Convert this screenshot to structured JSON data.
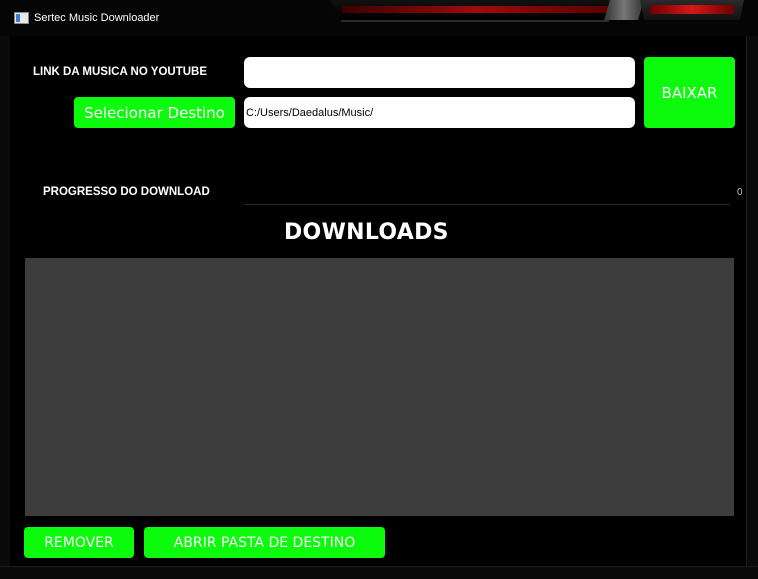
{
  "window": {
    "title": "Sertec Music  Downloader"
  },
  "form": {
    "link_label": "LINK DA MUSICA NO YOUTUBE",
    "link_value": "",
    "destino_button": "Selecionar Destino",
    "destino_value": "C:/Users/Daedalus/Music/",
    "baixar_button": "BAIXAR"
  },
  "progress": {
    "label": "PROGRESSO DO DOWNLOAD",
    "value": 0,
    "value_text": "0"
  },
  "downloads": {
    "heading": "DOWNLOADS",
    "items": []
  },
  "footer": {
    "remover_button": "REMOVER",
    "abrir_button": "ABRIR PASTA DE DESTINO"
  },
  "colors": {
    "accent": "#0cfb0c",
    "background": "#000000",
    "list_bg": "#3d3d3d"
  }
}
